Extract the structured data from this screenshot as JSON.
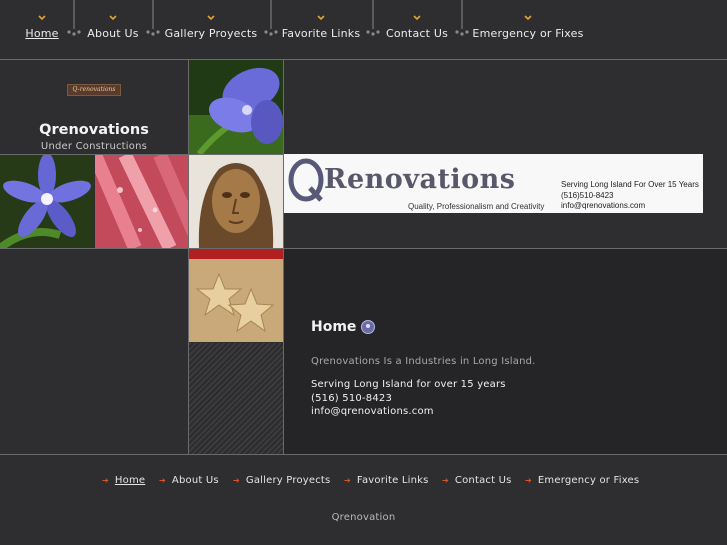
{
  "top_nav": {
    "items": [
      {
        "label": "Home"
      },
      {
        "label": "About Us"
      },
      {
        "label": "Gallery Proyects"
      },
      {
        "label": "Favorite Links"
      },
      {
        "label": "Contact Us"
      },
      {
        "label": "Emergency or Fixes"
      }
    ]
  },
  "brand": {
    "logo_text": "Q-renovations",
    "name": "Qrenovations",
    "tagline": "Under Constructions"
  },
  "banner": {
    "title": "Renovations",
    "tagline": "Quality, Professionalism and Creativity",
    "info": [
      "Serving Long Island For Over 15 Years",
      "(516)510-8423",
      "info@qrenovations.com"
    ]
  },
  "content": {
    "title": "Home",
    "intro": "Qrenovations Is a Industries in Long Island.",
    "lines": [
      "Serving Long Island for over 15 years",
      "(516) 510-8423",
      "info@qrenovations.com"
    ]
  },
  "footer_nav": {
    "items": [
      {
        "label": "Home"
      },
      {
        "label": "About Us"
      },
      {
        "label": "Gallery Proyects"
      },
      {
        "label": "Favorite Links"
      },
      {
        "label": "Contact Us"
      },
      {
        "label": "Emergency or Fixes"
      }
    ]
  },
  "footer": {
    "copyright": "Qrenovation"
  },
  "colors": {
    "background": "#2e2e30",
    "content_background": "#252527",
    "nav_chevron": "#e8a030",
    "footer_arrow": "#d9542c"
  },
  "icons": {
    "nav_chevron": "chevron-down-icon",
    "nav_separator": "separator-connector-icon",
    "home_bullet": "bullet-circle-icon",
    "footer_arrow": "arrow-right-icon"
  }
}
